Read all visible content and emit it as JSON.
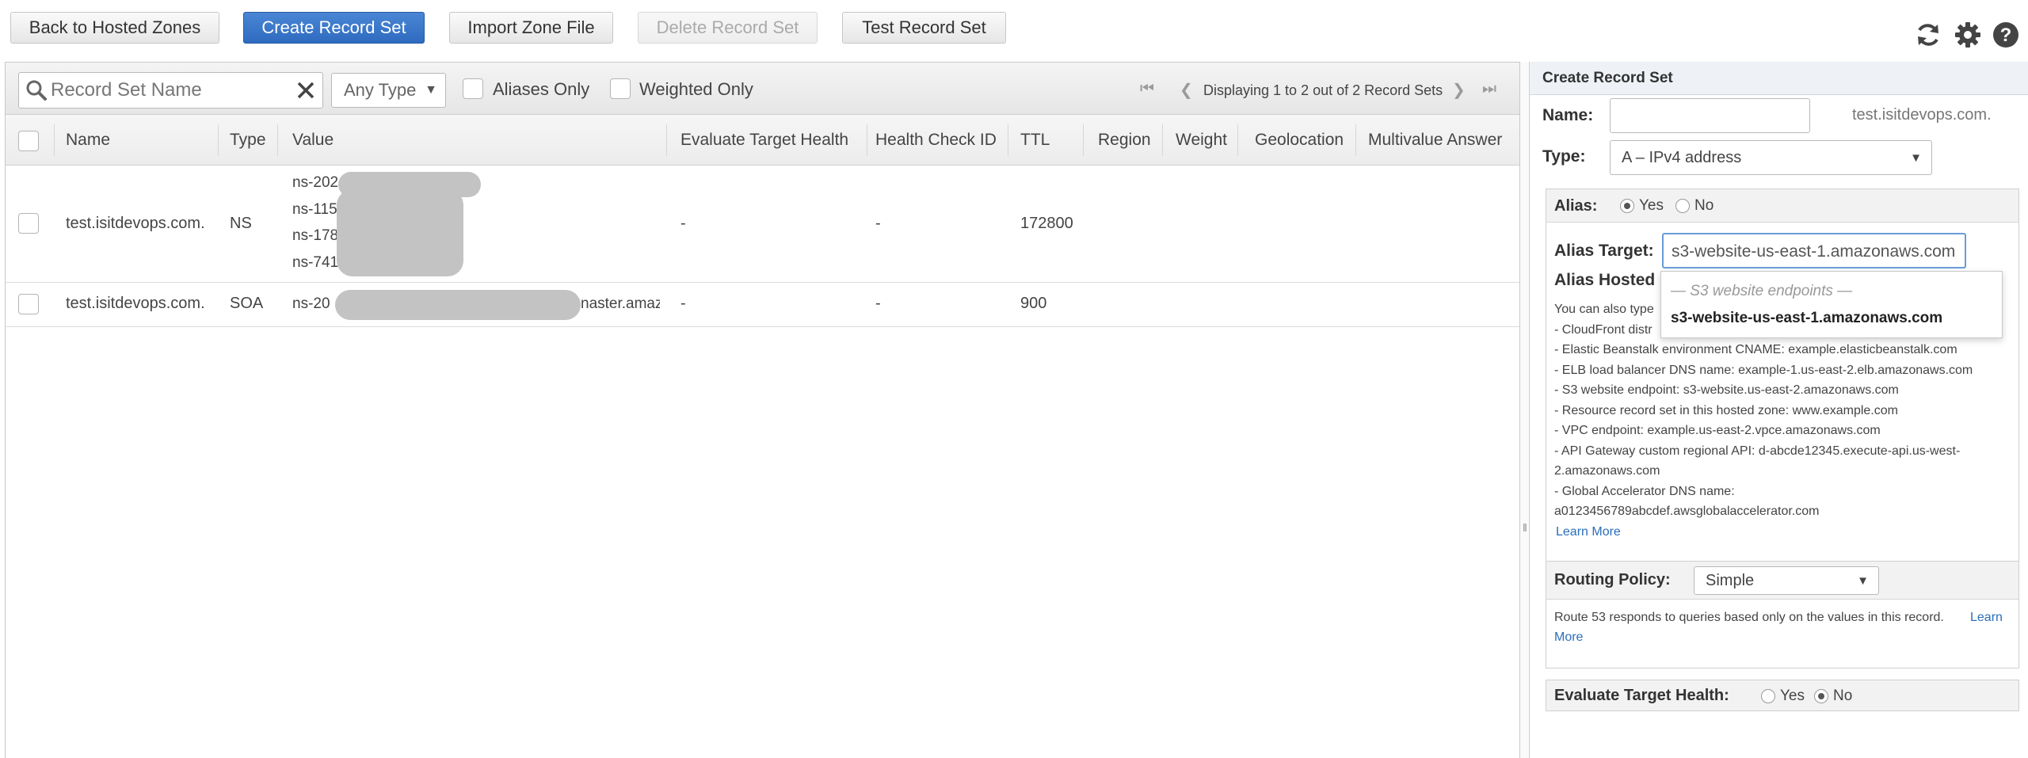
{
  "toolbar": {
    "back_label": "Back to Hosted Zones",
    "create_label": "Create Record Set",
    "import_label": "Import Zone File",
    "delete_label": "Delete Record Set",
    "test_label": "Test Record Set"
  },
  "filter": {
    "search_placeholder": "Record Set Name",
    "type_value": "Any Type",
    "aliases_only": "Aliases Only",
    "weighted_only": "Weighted Only",
    "pager_text": "Displaying 1 to 2 out of 2 Record Sets"
  },
  "table": {
    "columns": [
      "Name",
      "Type",
      "Value",
      "Evaluate Target Health",
      "Health Check ID",
      "TTL",
      "Region",
      "Weight",
      "Geolocation",
      "Multivalue Answer"
    ],
    "rows": [
      {
        "name": "test.isitdevops.com.",
        "type": "NS",
        "values": [
          "ns-202",
          "ns-115",
          "ns-178",
          "ns-741"
        ],
        "evaluate": "-",
        "health_check": "-",
        "ttl": "172800"
      },
      {
        "name": "test.isitdevops.com.",
        "type": "SOA",
        "value_prefix": "ns-20",
        "value_suffix": "naster.amaz",
        "evaluate": "-",
        "health_check": "-",
        "ttl": "900"
      }
    ]
  },
  "panel": {
    "title": "Create Record Set",
    "name_label": "Name:",
    "domain_suffix": "test.isitdevops.com.",
    "type_label": "Type:",
    "type_value": "A – IPv4 address",
    "alias_label": "Alias:",
    "yes": "Yes",
    "no": "No",
    "alias_selected": "Yes",
    "alias_target_label": "Alias Target:",
    "alias_target_value": "s3-website-us-east-1.amazonaws.com",
    "alias_hosted_label": "Alias Hosted",
    "help_intro": "You can also type",
    "help_items": [
      "-  CloudFront distr",
      "-  Elastic Beanstalk environment CNAME: example.elasticbeanstalk.com",
      "-  ELB load balancer DNS name: example-1.us-east-2.elb.amazonaws.com",
      "-  S3 website endpoint: s3-website.us-east-2.amazonaws.com",
      "-  Resource record set in this hosted zone: www.example.com",
      "-  VPC endpoint: example.us-east-2.vpce.amazonaws.com",
      "-  API Gateway custom regional API: d-abcde12345.execute-api.us-west-",
      "2.amazonaws.com",
      "-  Global Accelerator DNS name:",
      "a0123456789abcdef.awsglobalaccelerator.com"
    ],
    "learn_more": "Learn More",
    "dropdown_header": "— S3 website endpoints —",
    "dropdown_option": "s3-website-us-east-1.amazonaws.com",
    "routing_label": "Routing Policy:",
    "routing_value": "Simple",
    "routing_desc": "Route 53 responds to queries based only on the values in this record.",
    "routing_learn": "Learn",
    "routing_more": "More",
    "evaluate_label": "Evaluate Target Health:",
    "evaluate_selected": "No"
  },
  "colors": {
    "primary_button": "#2e6bc0",
    "link": "#2a6ebb",
    "focus_border": "#6a9bd8"
  },
  "icons": [
    "search-icon",
    "clear-icon",
    "refresh-icon",
    "settings-icon",
    "help-icon",
    "first-page-icon",
    "prev-page-icon",
    "next-page-icon",
    "last-page-icon"
  ]
}
